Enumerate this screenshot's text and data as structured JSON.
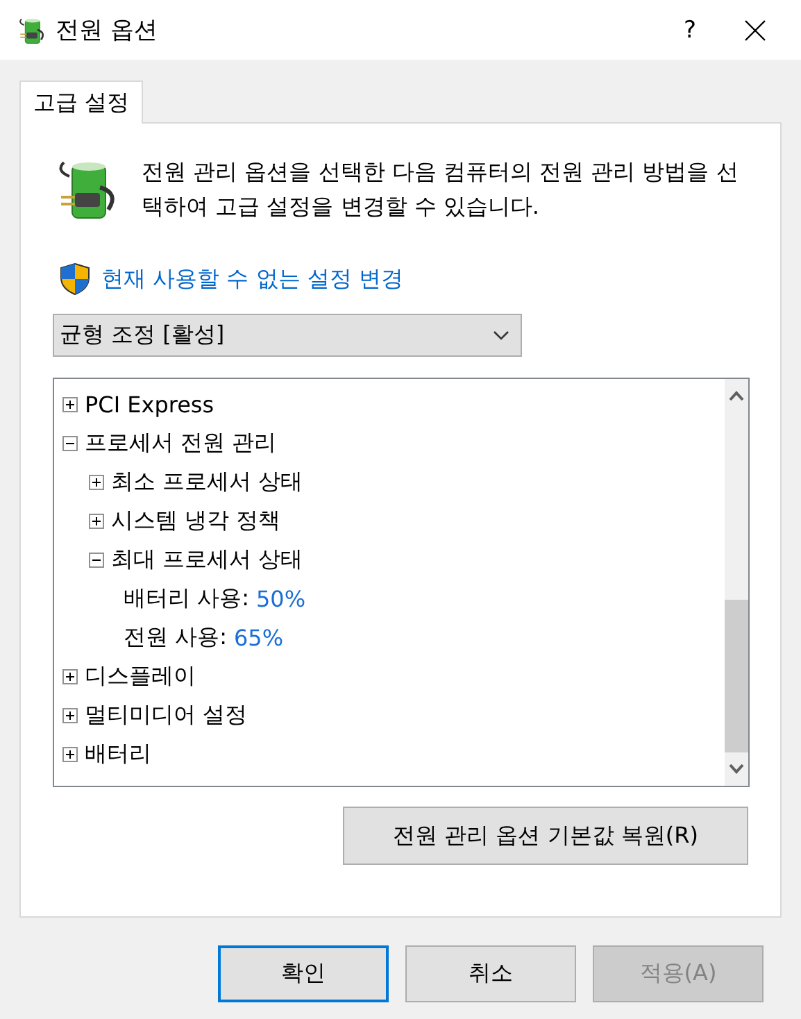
{
  "window": {
    "title": "전원 옵션",
    "help": "?"
  },
  "tabs": [
    {
      "label": "고급 설정",
      "selected": true
    }
  ],
  "description": "전원 관리 옵션을 선택한 다음 컴퓨터의 전원 관리 방법을 선택하여 고급 설정을 변경할 수 있습니다.",
  "admin_link": "현재 사용할 수 없는 설정 변경",
  "plan_dropdown": {
    "value": "균형 조정 [활성]"
  },
  "tree": [
    {
      "label": "PCI Express",
      "expanded": false
    },
    {
      "label": "프로세서 전원 관리",
      "expanded": true,
      "children": [
        {
          "label": "최소 프로세서 상태",
          "expanded": false
        },
        {
          "label": "시스템 냉각 정책",
          "expanded": false
        },
        {
          "label": "최대 프로세서 상태",
          "expanded": true,
          "children": [
            {
              "kind": "setting",
              "label": "배터리 사용:",
              "value": "50%"
            },
            {
              "kind": "setting",
              "label": "전원 사용:",
              "value": "65%"
            }
          ]
        }
      ]
    },
    {
      "label": "디스플레이",
      "expanded": false
    },
    {
      "label": "멀티미디어 설정",
      "expanded": false
    },
    {
      "label": "배터리",
      "expanded": false
    }
  ],
  "restore_button": "전원 관리 옵션 기본값 복원(R)",
  "buttons": [
    {
      "label": "확인",
      "default": true,
      "disabled": false
    },
    {
      "label": "취소",
      "default": false,
      "disabled": false
    },
    {
      "label": "적용(A)",
      "default": false,
      "disabled": true
    }
  ]
}
